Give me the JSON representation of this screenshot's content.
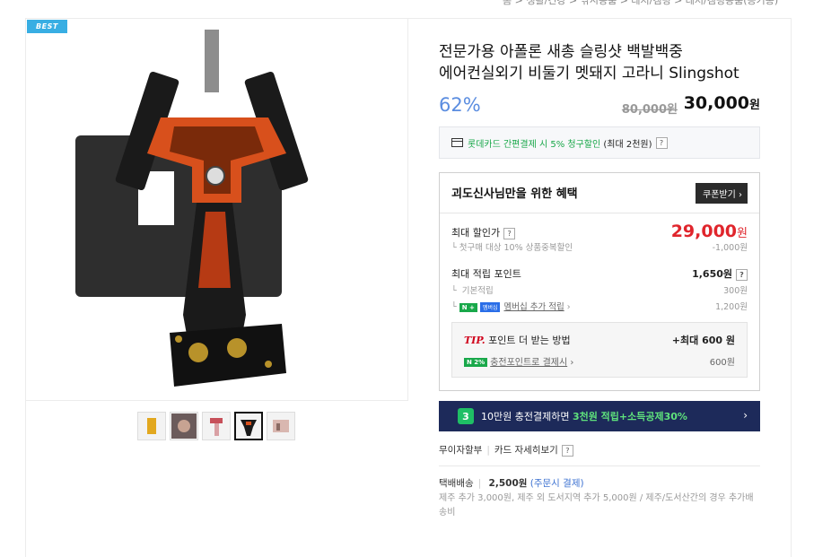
{
  "breadcrumb": "홈 > 생활/건강 > 낚시용품 > 레저/캠핑 > 레저/캠핑용품(공기총)",
  "badge": "BEST",
  "product": {
    "title_line1": "전문가용 아폴론 새총 슬링샷 백발백중",
    "title_line2": "에어컨실외기 비둘기 멧돼지 고라니 Slingshot",
    "discount_rate": "62%",
    "original_price": "80,000원",
    "sale_price": "30,000",
    "sale_unit": "원"
  },
  "card_promo": {
    "text": "롯데카드 간편결제 시 5% 청구할인",
    "limit": "(최대 2천원)",
    "help": "?"
  },
  "benefit": {
    "header": "괴도신사님만을 위한 혜택",
    "coupon_button": "쿠폰받기",
    "max_discount_label": "최대 할인가",
    "max_discount_value": "29,000",
    "max_discount_unit": "원",
    "first_purchase_note": "첫구매 대상 10% 상품중복할인",
    "first_purchase_amount": "-1,000원",
    "max_points_label": "최대 적립 포인트",
    "max_points_value": "1,650원",
    "basic_label": "기본적립",
    "basic_value": "300원",
    "membership_badge": "멤버십",
    "membership_label": "멤버십 추가 적립",
    "membership_value": "1,200원",
    "tip_label": "TIP.",
    "tip_text": "포인트 더 받는 방법",
    "tip_max": "+최대 600 원",
    "charge_badge": "2%",
    "charge_label": "충전포인트로 결제시",
    "charge_value": "600원"
  },
  "banner": {
    "badge": "3",
    "text_plain": "10만원 충전결제하면 ",
    "text_highlight": "3천원 적립+소득공제30%",
    "chevron": "›"
  },
  "installment": {
    "label": "무이자할부",
    "detail": "카드 자세히보기",
    "help": "?"
  },
  "shipping": {
    "label": "택배배송",
    "fee": "2,500원",
    "fee_note": "(주문시 결제)",
    "extra": "제주 추가 3,000원, 제주 외 도서지역 추가 5,000원 / 제주/도서산간의 경우 추가배송비"
  },
  "colors": {
    "accent_blue": "#5b8de0",
    "sale_red": "#e0252c",
    "naver_green": "#19a84a",
    "banner_bg": "#1d2a5a"
  }
}
